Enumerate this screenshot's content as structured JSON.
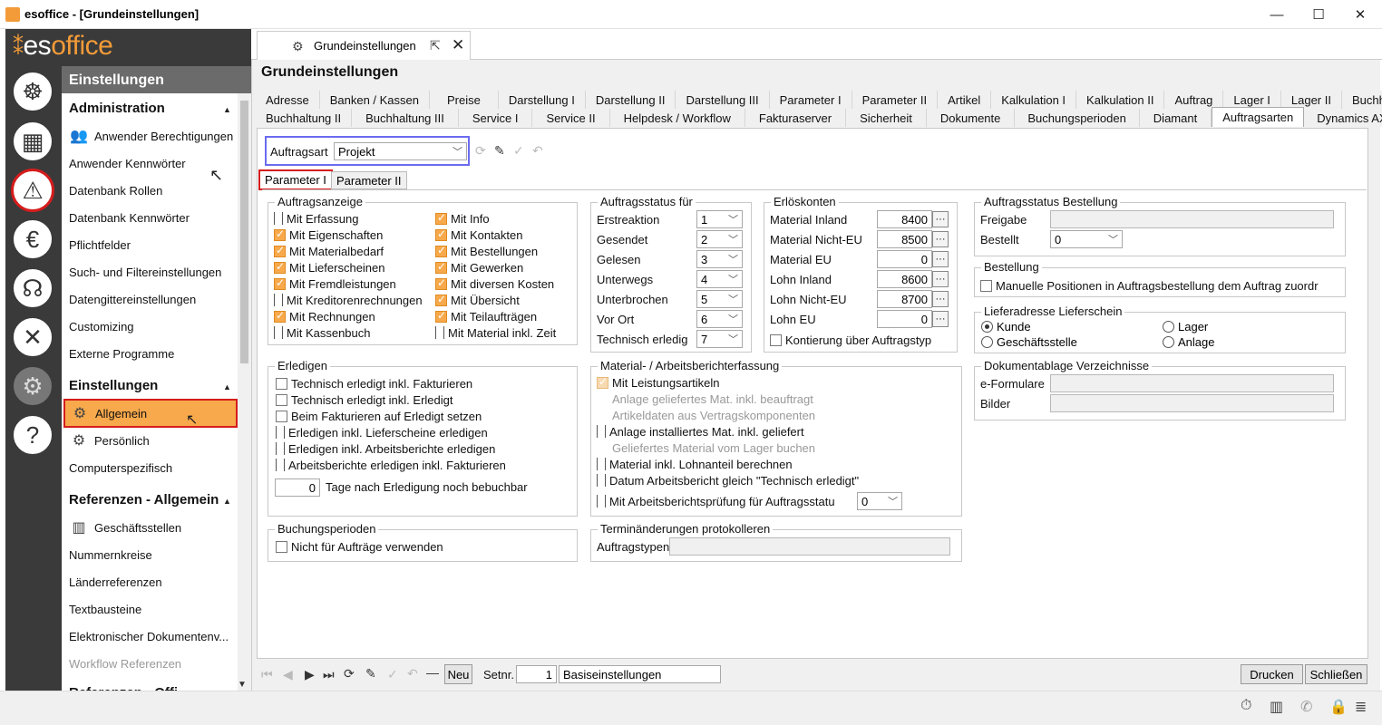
{
  "window": {
    "title": "esoffice - [Grundeinstellungen]",
    "minimize": "—",
    "maximize": "☐",
    "close": "✕"
  },
  "brand": {
    "pre": "es",
    "post": "office"
  },
  "nav_icons": [
    "settings-wheel-icon",
    "calendar-icon",
    "alarm-light-icon",
    "euro-icon",
    "headset-icon",
    "tools-icon",
    "gears-icon",
    "help-icon"
  ],
  "sidebar": {
    "header": "Einstellungen",
    "sections": [
      {
        "title": "Administration"
      },
      {
        "title": "Einstellungen"
      },
      {
        "title": "Referenzen - Allgemein"
      },
      {
        "title": "Referenzen - Offi"
      }
    ],
    "admin_items": [
      "Anwender Berechtigungen",
      "Anwender Kennwörter",
      "Datenbank Rollen",
      "Datenbank Kennwörter",
      "Pflichtfelder",
      "Such- und Filtereinstellungen",
      "Datengittereinstellungen",
      "Customizing",
      "Externe Programme"
    ],
    "settings_items": [
      "Allgemein",
      "Persönlich",
      "Computerspezifisch"
    ],
    "ref_items": [
      "Geschäftsstellen",
      "Nummernkreise",
      "Länderreferenzen",
      "Textbausteine",
      "Elektronischer Dokumentenv...",
      "Workflow Referenzen"
    ]
  },
  "doc_tab": {
    "label": "Grundeinstellungen"
  },
  "page_title": "Grundeinstellungen",
  "tabs_row1": [
    "Adresse",
    "Banken / Kassen",
    "Preise",
    "Darstellung I",
    "Darstellung II",
    "Darstellung III",
    "Parameter I",
    "Parameter II",
    "Artikel",
    "Kalkulation I",
    "Kalkulation II",
    "Auftrag",
    "Lager I",
    "Lager II",
    "Buchhaltung I"
  ],
  "tabs_row2": [
    "Buchhaltung II",
    "Buchhaltung III",
    "Service I",
    "Service II",
    "Helpdesk / Workflow",
    "Fakturaserver",
    "Sicherheit",
    "Dokumente",
    "Buchungsperioden",
    "Diamant",
    "Auftragsarten",
    "Dynamics AX"
  ],
  "auftragsart": {
    "label": "Auftragsart",
    "value": "Projekt"
  },
  "subtabs": [
    "Parameter I",
    "Parameter II"
  ],
  "auftragsanzeige": {
    "title": "Auftragsanzeige",
    "col1": [
      {
        "label": "Mit Erfassung",
        "state": "tri"
      },
      {
        "label": "Mit Eigenschaften",
        "state": "chk"
      },
      {
        "label": "Mit Materialbedarf",
        "state": "chk"
      },
      {
        "label": "Mit Lieferscheinen",
        "state": "chk"
      },
      {
        "label": "Mit Fremdleistungen",
        "state": "chk"
      },
      {
        "label": "Mit Kreditorenrechnungen",
        "state": "tri"
      },
      {
        "label": "Mit Rechnungen",
        "state": "chk"
      },
      {
        "label": "Mit Kassenbuch",
        "state": "tri"
      }
    ],
    "col2": [
      {
        "label": "Mit Info",
        "state": "chk"
      },
      {
        "label": "Mit Kontakten",
        "state": "chk"
      },
      {
        "label": "Mit Bestellungen",
        "state": "chk"
      },
      {
        "label": "Mit Gewerken",
        "state": "chk"
      },
      {
        "label": "Mit diversen Kosten",
        "state": "chk"
      },
      {
        "label": "Mit Übersicht",
        "state": "chk"
      },
      {
        "label": "Mit Teilaufträgen",
        "state": "chk"
      },
      {
        "label": "Mit Material inkl. Zeit",
        "state": "tri"
      }
    ]
  },
  "auftragsstatus": {
    "title": "Auftragsstatus für",
    "rows": [
      {
        "label": "Erstreaktion",
        "value": "1"
      },
      {
        "label": "Gesendet",
        "value": "2"
      },
      {
        "label": "Gelesen",
        "value": "3"
      },
      {
        "label": "Unterwegs",
        "value": "4"
      },
      {
        "label": "Unterbrochen",
        "value": "5"
      },
      {
        "label": "Vor Ort",
        "value": "6"
      },
      {
        "label": "Technisch erledig",
        "value": "7"
      }
    ]
  },
  "erloeskonten": {
    "title": "Erlöskonten",
    "rows": [
      {
        "label": "Material Inland",
        "value": "8400"
      },
      {
        "label": "Material Nicht-EU",
        "value": "8500"
      },
      {
        "label": "Material EU",
        "value": "0"
      },
      {
        "label": "Lohn Inland",
        "value": "8600"
      },
      {
        "label": "Lohn Nicht-EU",
        "value": "8700"
      },
      {
        "label": "Lohn EU",
        "value": "0"
      }
    ],
    "kontierung": "Kontierung über Auftragstyp"
  },
  "bestellstatus": {
    "title": "Auftragsstatus Bestellung",
    "freigabe": "Freigabe",
    "bestellt": "Bestellt",
    "bestellt_value": "0"
  },
  "bestellung": {
    "title": "Bestellung",
    "option": "Manuelle Positionen in Auftragsbestellung dem Auftrag zuordr"
  },
  "lieferadresse": {
    "title": "Lieferadresse Lieferschein",
    "options": [
      "Kunde",
      "Lager",
      "Geschäftsstelle",
      "Anlage"
    ]
  },
  "dokumentablage": {
    "title": "Dokumentablage Verzeichnisse",
    "rows": [
      "e-Formulare",
      "Bilder"
    ]
  },
  "erledigen": {
    "title": "Erledigen",
    "rows": [
      {
        "label": "Technisch erledigt inkl. Fakturieren",
        "state": "off"
      },
      {
        "label": "Technisch erledigt inkl. Erledigt",
        "state": "off"
      },
      {
        "label": "Beim Fakturieren auf Erledigt setzen",
        "state": "off"
      },
      {
        "label": "Erledigen inkl. Lieferscheine erledigen",
        "state": "tri"
      },
      {
        "label": "Erledigen inkl. Arbeitsberichte erledigen",
        "state": "tri"
      },
      {
        "label": "Arbeitsberichte erledigen inkl. Fakturieren",
        "state": "tri"
      }
    ],
    "days_value": "0",
    "days_label": "Tage nach Erledigung noch bebuchbar"
  },
  "material": {
    "title": "Material- / Arbeitsberichterfassung",
    "rows": [
      {
        "label": "Mit Leistungsartikeln",
        "state": "dchk"
      },
      {
        "label": "Anlage geliefertes Mat. inkl. beauftragt",
        "state": "dis"
      },
      {
        "label": "Artikeldaten aus Vertragskomponenten",
        "state": "dis"
      },
      {
        "label": "Anlage installiertes Mat. inkl. geliefert",
        "state": "tri"
      },
      {
        "label": "Geliefertes Material vom Lager buchen",
        "state": "dis"
      },
      {
        "label": "Material inkl. Lohnanteil berechnen",
        "state": "tri"
      },
      {
        "label": "Datum Arbeitsbericht gleich \"Technisch erledigt\"",
        "state": "tri"
      },
      {
        "label": "Mit Arbeitsberichtsprüfung für Auftragsstatu",
        "state": "tri"
      }
    ],
    "pruefung_value": "0"
  },
  "buchungsperioden": {
    "title": "Buchungsperioden",
    "option": "Nicht für Aufträge verwenden"
  },
  "termin": {
    "title": "Terminänderungen protokolleren",
    "label": "Auftragstypen"
  },
  "bottom": {
    "neu": "Neu",
    "setnr_label": "Setnr.",
    "setnr_value": "1",
    "set_name": "Basiseinstellungen",
    "drucken": "Drucken",
    "schliessen": "Schließen"
  },
  "accent_orange": "#f7a94b",
  "highlight_red": "#d51c1c"
}
